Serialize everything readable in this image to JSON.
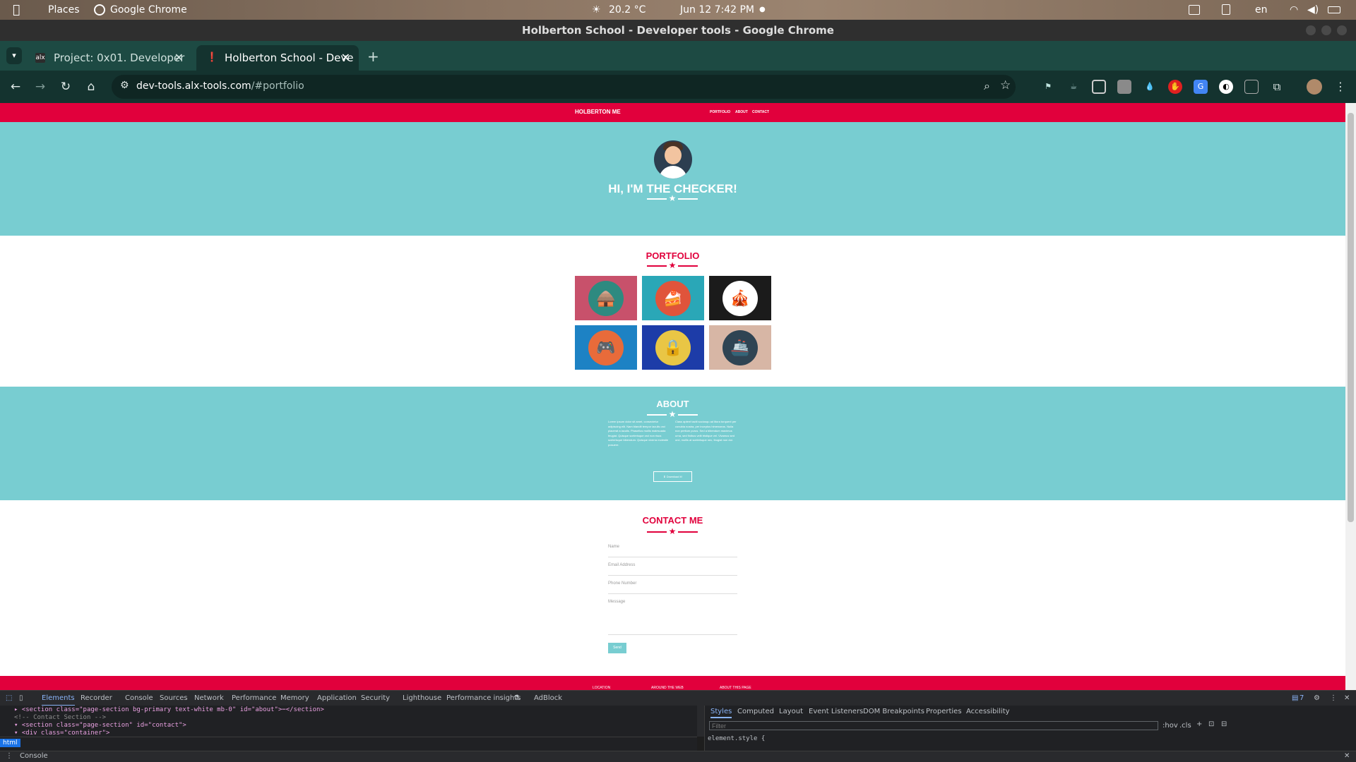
{
  "os_bar": {
    "places": "Places",
    "app": "Google Chrome",
    "weather": "20.2 °C",
    "datetime": "Jun 12  7:42 PM",
    "lang": "en"
  },
  "window_title": "Holberton School - Developer tools - Google Chrome",
  "tabs": [
    {
      "label": "Project: 0x01. Developer",
      "active": false
    },
    {
      "label": "Holberton School - Deve",
      "active": true
    }
  ],
  "url": {
    "host": "dev-tools.alx-tools.com",
    "path": "/#portfolio"
  },
  "site": {
    "brand": "HOLBERTON ME",
    "nav": [
      "PORTFOLIO",
      "ABOUT",
      "CONTACT"
    ],
    "hero_title": "HI, I'M THE CHECKER!",
    "portfolio_title": "PORTFOLIO",
    "portfolio_items": [
      {
        "icon": "cabin-icon",
        "bg": "#c8516b",
        "circle": "#2e8a80"
      },
      {
        "icon": "cake-icon",
        "bg": "#2aa7b7",
        "circle": "#e0543b"
      },
      {
        "icon": "circus-tent-icon",
        "bg": "#1b1b1b",
        "circle": "#ffffff"
      },
      {
        "icon": "game-controller-icon",
        "bg": "#1d82c4",
        "circle": "#e86b3a"
      },
      {
        "icon": "safe-icon",
        "bg": "#1d3ca8",
        "circle": "#e9c645"
      },
      {
        "icon": "submarine-icon",
        "bg": "#d7b6a5",
        "circle": "#2f4453"
      }
    ],
    "about_title": "ABOUT",
    "about_col1": "Lorem ipsum dolor sit amet, consectetur adipiscing elit. Nam blandit tempor iaculis orci placerat a iaculis. Phasellus mollis malesuada feugiat. Quisque scelerisque orci non risus scelerisque bibendum. Quisque viverra molestie posuere.",
    "about_col2": "Class aptent taciti sociosqu ad litora torquent per conubia nostra, per inceptos himenaeos. Nulla non pretium purus. Sed a bibendum maximus urna, sed finibus velit tristique vel. Vivamus sed orci, mollis at scelerisque nec, feugiat non dui.",
    "download_label": "Download it!",
    "contact_title": "CONTACT ME",
    "fields": [
      "Name",
      "Email Address",
      "Phone Number",
      "Message"
    ],
    "send_label": "Send",
    "footer_labels": [
      "LOCATION",
      "AROUND THE WEB",
      "ABOUT THIS PAGE"
    ]
  },
  "colors": {
    "primary": "#e1003c",
    "secondary": "#78cdd1"
  },
  "devtools": {
    "tabs": [
      "Elements",
      "Recorder",
      "Console",
      "Sources",
      "Network",
      "Performance",
      "Memory",
      "Application",
      "Security",
      "Lighthouse",
      "Performance insights",
      "AdBlock"
    ],
    "issues_count": "7",
    "code_lines": [
      "▸ <section class=\"page-section bg-primary text-white mb-0\" id=\"about\">⋯</section>",
      "  <!-- Contact Section -->",
      "▾ <section class=\"page-section\" id=\"contact\">",
      "    ▾ <div class=\"container\">"
    ],
    "style_tabs": [
      "Styles",
      "Computed",
      "Layout",
      "Event Listeners",
      "DOM Breakpoints",
      "Properties",
      "Accessibility"
    ],
    "filter_placeholder": "Filter",
    "hov": ":hov",
    "cls": ".cls",
    "element_style": "element.style {",
    "crumb": "html",
    "drawer_label": "Console"
  }
}
